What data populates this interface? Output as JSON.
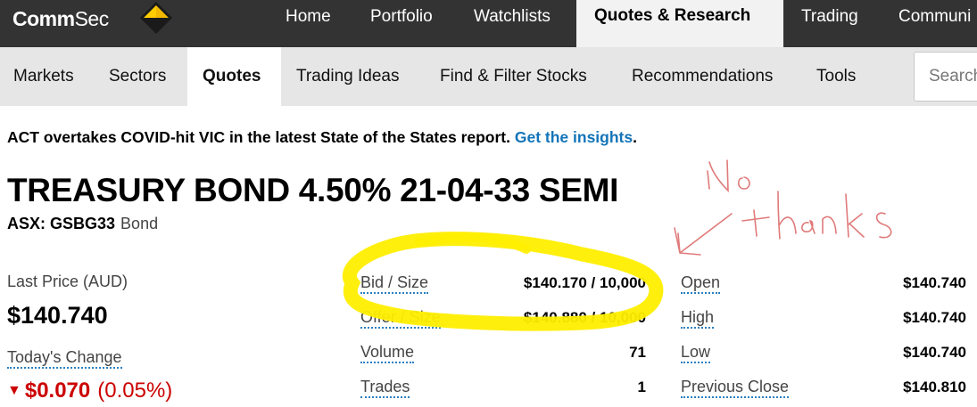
{
  "brand": {
    "logo_bold": "Comm",
    "logo_rest": "Sec",
    "accent": "#ffcc00"
  },
  "top_nav": [
    {
      "label": "Home"
    },
    {
      "label": "Portfolio"
    },
    {
      "label": "Watchlists"
    },
    {
      "label": "Quotes & Research",
      "active": true
    },
    {
      "label": "Trading"
    },
    {
      "label": "Communi"
    }
  ],
  "sub_nav": [
    {
      "label": "Markets"
    },
    {
      "label": "Sectors"
    },
    {
      "label": "Quotes",
      "active": true
    },
    {
      "label": "Trading Ideas"
    },
    {
      "label": "Find & Filter Stocks"
    },
    {
      "label": "Recommendations"
    },
    {
      "label": "Tools"
    }
  ],
  "search": {
    "placeholder": "Search"
  },
  "banner": {
    "text": "ACT overtakes COVID-hit VIC in the latest State of the States report. ",
    "link": "Get the insights",
    "end": "."
  },
  "security": {
    "title": "TREASURY BOND 4.50% 21-04-33 SEMI",
    "code": "ASX: GSBG33",
    "type": "Bond"
  },
  "price": {
    "last_price_label": "Last Price (AUD)",
    "last_price": "$140.740",
    "change_label": "Today's Change",
    "change_amount": "$0.070",
    "change_percent": "(0.05%)",
    "change_color": "#cc0000"
  },
  "stats_left": [
    {
      "label": "Bid / Size",
      "value": "$140.170 / 10,000"
    },
    {
      "label": "Offer / Size",
      "value": "$140.880 / 10,000"
    },
    {
      "label": "Volume",
      "value": "71"
    },
    {
      "label": "Trades",
      "value": "1"
    }
  ],
  "stats_right": [
    {
      "label": "Open",
      "value": "$140.740"
    },
    {
      "label": "High",
      "value": "$140.740"
    },
    {
      "label": "Low",
      "value": "$140.740"
    },
    {
      "label": "Previous Close",
      "value": "$140.810"
    }
  ],
  "annotation": {
    "highlight_color": "#ffee00",
    "ink_color": "#e07a7a",
    "word1": "No",
    "word2": "thanks"
  }
}
